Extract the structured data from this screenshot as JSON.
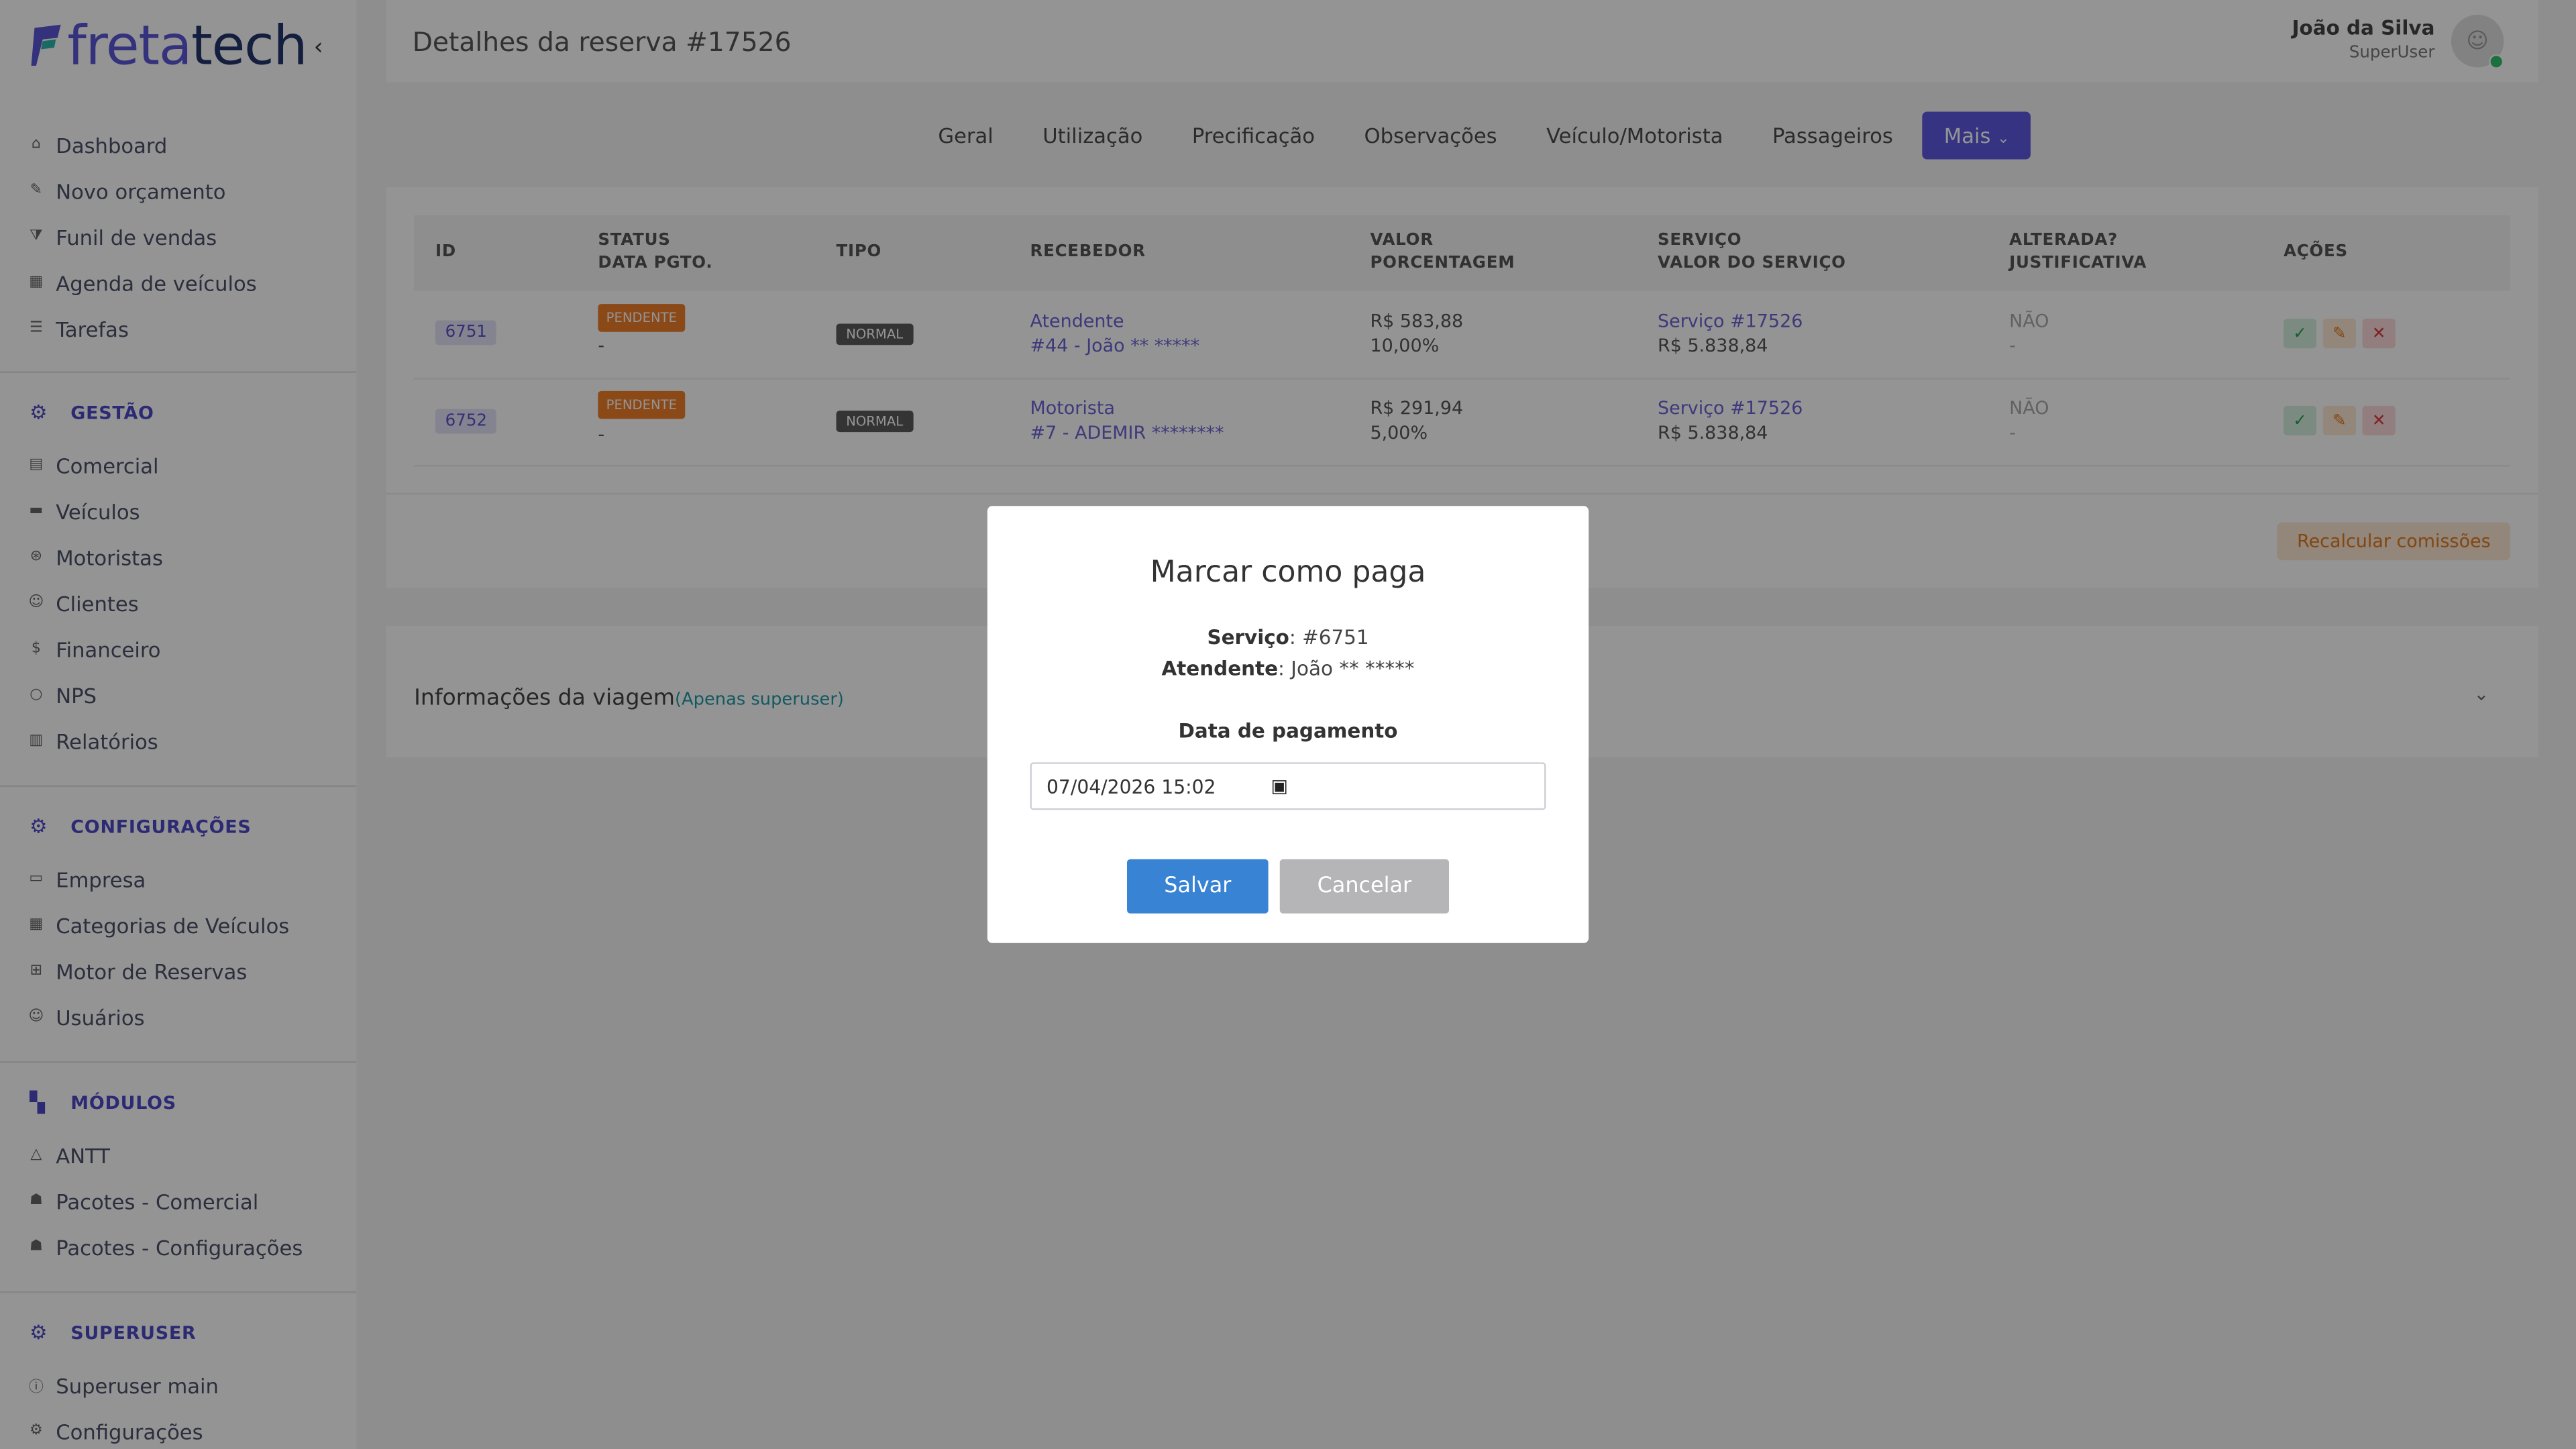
{
  "logo": {
    "part1": "freta",
    "part2": "tech"
  },
  "sidebar": {
    "main_items": [
      {
        "label": "Dashboard",
        "icon": "home-icon"
      },
      {
        "label": "Novo orçamento",
        "icon": "edit-icon"
      },
      {
        "label": "Funil de vendas",
        "icon": "funnel-icon"
      },
      {
        "label": "Agenda de veículos",
        "icon": "calendar-icon"
      },
      {
        "label": "Tarefas",
        "icon": "list-icon"
      }
    ],
    "gestao": {
      "title": "GESTÃO",
      "items": [
        {
          "label": "Comercial"
        },
        {
          "label": "Veículos"
        },
        {
          "label": "Motoristas"
        },
        {
          "label": "Clientes"
        },
        {
          "label": "Financeiro"
        },
        {
          "label": "NPS"
        },
        {
          "label": "Relatórios"
        }
      ]
    },
    "config": {
      "title": "CONFIGURAÇÕES",
      "items": [
        {
          "label": "Empresa"
        },
        {
          "label": "Categorias de Veículos"
        },
        {
          "label": "Motor de Reservas"
        },
        {
          "label": "Usuários"
        }
      ]
    },
    "modulos": {
      "title": "MÓDULOS",
      "items": [
        {
          "label": "ANTT"
        },
        {
          "label": "Pacotes - Comercial"
        },
        {
          "label": "Pacotes - Configurações"
        }
      ]
    },
    "superuser": {
      "title": "SUPERUSER",
      "items": [
        {
          "label": "Superuser main"
        },
        {
          "label": "Configurações"
        }
      ]
    }
  },
  "header": {
    "title": "Detalhes da reserva #17526",
    "user_name": "João da Silva",
    "user_role": "SuperUser"
  },
  "tabs": [
    "Geral",
    "Utilização",
    "Precificação",
    "Observações",
    "Veículo/Motorista",
    "Passageiros",
    "Mais"
  ],
  "table": {
    "headers": {
      "id": "ID",
      "status": "STATUS",
      "data_pgto": "DATA PGTO.",
      "tipo": "TIPO",
      "recebedor": "RECEBEDOR",
      "valor": "VALOR",
      "porcentagem": "PORCENTAGEM",
      "servico": "SERVIÇO",
      "valor_servico": "VALOR DO SERVIÇO",
      "alterada": "ALTERADA?",
      "justificativa": "JUSTIFICATIVA",
      "acoes": "AÇÕES"
    },
    "rows": [
      {
        "id": "6751",
        "status": "PENDENTE",
        "data_pgto": "-",
        "tipo": "NORMAL",
        "recebedor": "Atendente",
        "recebedor_detail": "#44 - João ** *****",
        "valor": "R$ 583,88",
        "porcentagem": "10,00%",
        "servico": "Serviço #17526",
        "valor_servico": "R$ 5.838,84",
        "alterada": "NÃO",
        "justificativa": "-"
      },
      {
        "id": "6752",
        "status": "PENDENTE",
        "data_pgto": "-",
        "tipo": "NORMAL",
        "recebedor": "Motorista",
        "recebedor_detail": "#7 - ADEMIR ********",
        "valor": "R$ 291,94",
        "porcentagem": "5,00%",
        "servico": "Serviço #17526",
        "valor_servico": "R$ 5.838,84",
        "alterada": "NÃO",
        "justificativa": "-"
      }
    ],
    "recalc_label": "Recalcular comissões"
  },
  "info": {
    "title": "Informações da viagem",
    "subtitle": "(Apenas superuser)"
  },
  "modal": {
    "title": "Marcar como paga",
    "servico_label": "Serviço",
    "servico_value": ": #6751",
    "atendente_label": "Atendente",
    "atendente_value": ": João ** *****",
    "date_label": "Data de pagamento",
    "date_value": "07/04/2026 15:02",
    "save_label": "Salvar",
    "cancel_label": "Cancelar"
  },
  "colors": {
    "accent": "#5e58e0",
    "save": "#3883d4",
    "pending": "#f07f2a"
  }
}
